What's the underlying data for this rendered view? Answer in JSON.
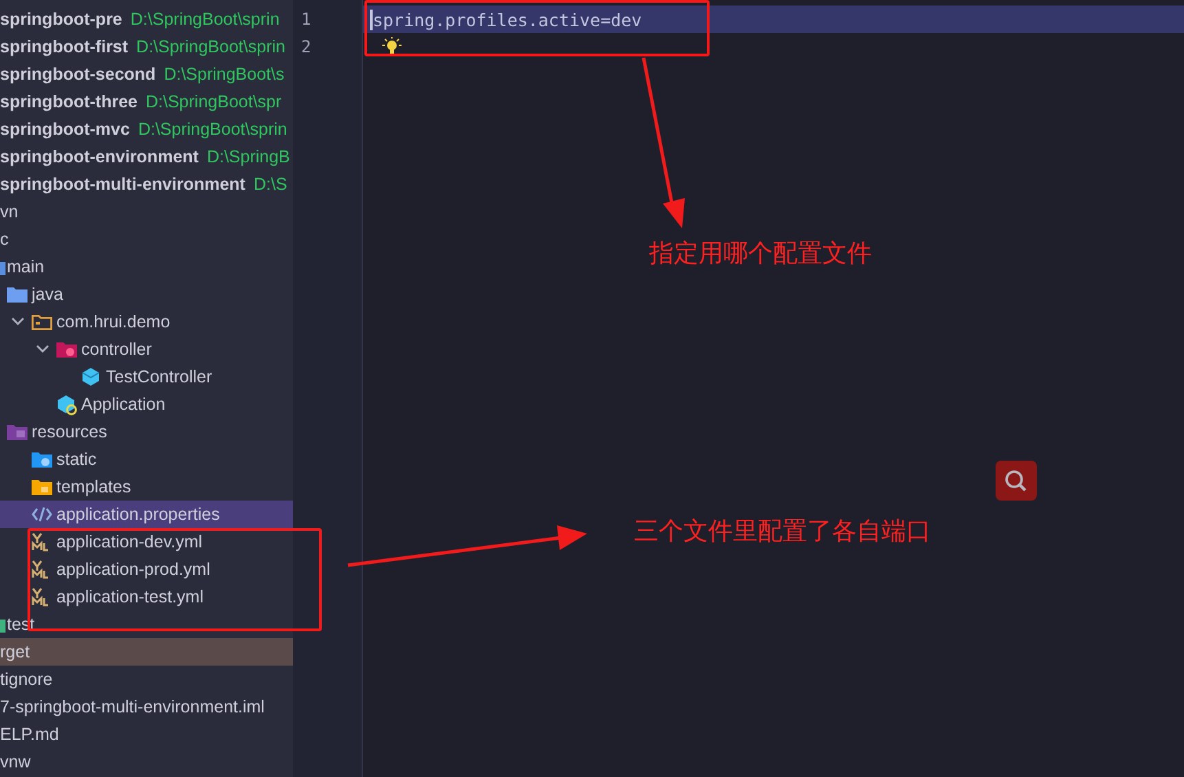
{
  "project_tree": [
    {
      "label": "springboot-pre",
      "path": "D:\\SpringBoot\\sprin",
      "bold": true,
      "expanded": false,
      "selected": false,
      "highlighted": false
    },
    {
      "label": "springboot-first",
      "path": "D:\\SpringBoot\\sprin",
      "bold": true,
      "expanded": false,
      "selected": false,
      "highlighted": false
    },
    {
      "label": "springboot-second",
      "path": "D:\\SpringBoot\\s",
      "bold": true,
      "expanded": false,
      "selected": false,
      "highlighted": false
    },
    {
      "label": "springboot-three",
      "path": "D:\\SpringBoot\\spr",
      "bold": true,
      "expanded": false,
      "selected": false,
      "highlighted": false
    },
    {
      "label": "springboot-mvc",
      "path": "D:\\SpringBoot\\sprin",
      "bold": true,
      "expanded": false,
      "selected": false,
      "highlighted": false
    },
    {
      "label": "springboot-environment",
      "path": "D:\\SpringB",
      "bold": true,
      "expanded": false,
      "selected": false,
      "highlighted": false
    },
    {
      "label": "springboot-multi-environment",
      "path": "D:\\S",
      "bold": true,
      "expanded": false,
      "selected": false,
      "highlighted": false
    },
    {
      "label": "vn",
      "bold": false,
      "expanded": false,
      "selected": false,
      "highlighted": false
    },
    {
      "label": "c",
      "bold": false,
      "expanded": false,
      "selected": false,
      "highlighted": false,
      "children": [
        {
          "label": "main",
          "bold": false,
          "kind": "folder",
          "expanded": false,
          "selected": false,
          "highlighted": false,
          "children": [
            {
              "label": "java",
              "bold": false,
              "kind": "source-folder",
              "expanded": false,
              "selected": false,
              "highlighted": false,
              "children": [
                {
                  "label": "com.hrui.demo",
                  "bold": false,
                  "kind": "package",
                  "expanded": true,
                  "selected": false,
                  "highlighted": false,
                  "children": [
                    {
                      "label": "controller",
                      "bold": false,
                      "kind": "controller-package",
                      "expanded": true,
                      "selected": false,
                      "highlighted": false,
                      "children": [
                        {
                          "label": "TestController",
                          "bold": false,
                          "kind": "class",
                          "expanded": false,
                          "selected": false,
                          "highlighted": false
                        }
                      ]
                    },
                    {
                      "label": "Application",
                      "bold": false,
                      "kind": "app-class",
                      "expanded": false,
                      "selected": false,
                      "highlighted": false
                    }
                  ]
                }
              ]
            },
            {
              "label": "resources",
              "bold": false,
              "kind": "resource-folder",
              "expanded": false,
              "selected": false,
              "highlighted": false,
              "children": [
                {
                  "label": "static",
                  "bold": false,
                  "kind": "web-folder",
                  "expanded": false,
                  "selected": false,
                  "highlighted": false
                },
                {
                  "label": "templates",
                  "bold": false,
                  "kind": "template-folder",
                  "expanded": false,
                  "selected": false,
                  "highlighted": false
                },
                {
                  "label": "application.properties",
                  "bold": false,
                  "kind": "properties",
                  "expanded": false,
                  "selected": true,
                  "highlighted": false
                },
                {
                  "label": "application-dev.yml",
                  "bold": false,
                  "kind": "yaml",
                  "expanded": false,
                  "selected": false,
                  "highlighted": false
                },
                {
                  "label": "application-prod.yml",
                  "bold": false,
                  "kind": "yaml",
                  "expanded": false,
                  "selected": false,
                  "highlighted": false
                },
                {
                  "label": "application-test.yml",
                  "bold": false,
                  "kind": "yaml",
                  "expanded": false,
                  "selected": false,
                  "highlighted": false
                }
              ]
            }
          ]
        },
        {
          "label": "test",
          "bold": false,
          "kind": "test-folder",
          "expanded": false,
          "selected": false,
          "highlighted": false
        }
      ]
    },
    {
      "label": "rget",
      "bold": false,
      "expanded": false,
      "selected": false,
      "highlighted": true
    },
    {
      "label": "tignore",
      "bold": false,
      "expanded": false,
      "selected": false,
      "highlighted": false
    },
    {
      "label": "7-springboot-multi-environment.iml",
      "bold": false,
      "expanded": false,
      "selected": false,
      "highlighted": false
    },
    {
      "label": "ELP.md",
      "bold": false,
      "expanded": false,
      "selected": false,
      "highlighted": false
    },
    {
      "label": "vnw",
      "bold": false,
      "expanded": false,
      "selected": false,
      "highlighted": false
    }
  ],
  "editor": {
    "lines": [
      {
        "number": "1",
        "text": "spring.profiles.active=dev",
        "current": true,
        "bulb": false
      },
      {
        "number": "2",
        "current": false,
        "bulb": true
      }
    ]
  },
  "annotations": [
    {
      "text": "指定用哪个配置文件"
    },
    {
      "text": "三个文件里配置了各自端口"
    }
  ]
}
